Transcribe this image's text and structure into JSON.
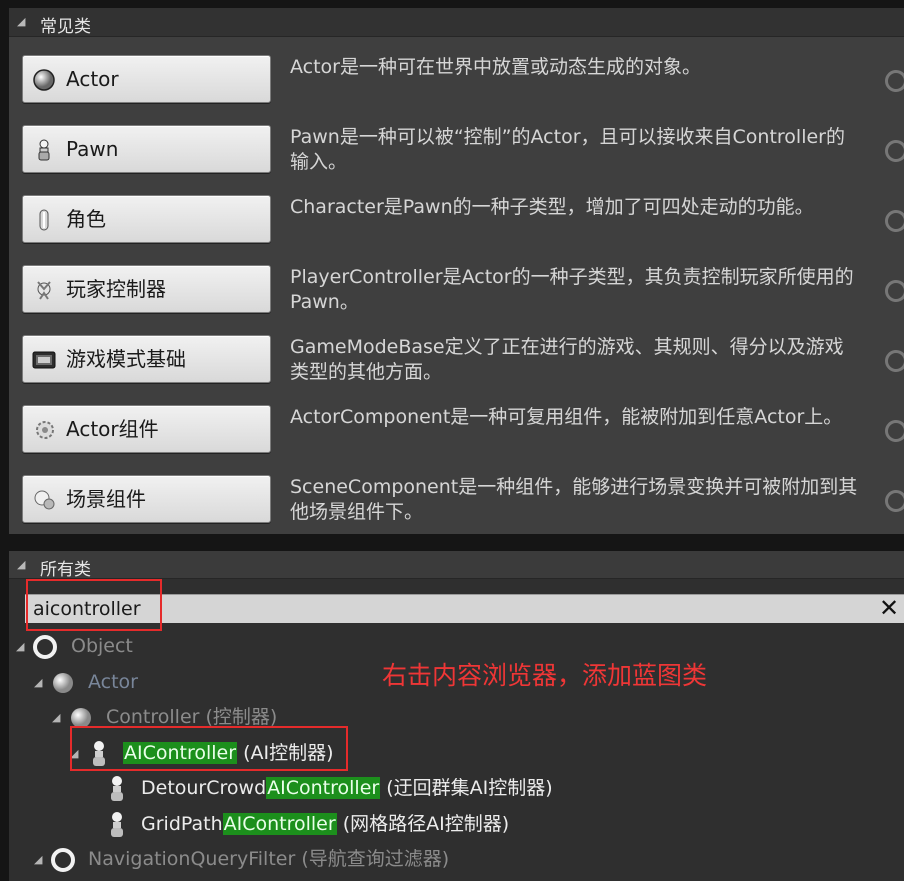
{
  "common": {
    "title": "常见类",
    "items": [
      {
        "label": "Actor",
        "icon": "actor-sphere-icon",
        "desc": "Actor是一种可在世界中放置或动态生成的对象。"
      },
      {
        "label": "Pawn",
        "icon": "pawn-icon",
        "desc": "Pawn是一种可以被“控制”的Actor，且可以接收来自Controller的输入。"
      },
      {
        "label": "角色",
        "icon": "character-icon",
        "desc": "Character是Pawn的一种子类型，增加了可四处走动的功能。"
      },
      {
        "label": "玩家控制器",
        "icon": "player-controller-icon",
        "desc": "PlayerController是Actor的一种子类型，其负责控制玩家所使用的Pawn。"
      },
      {
        "label": "游戏模式基础",
        "icon": "game-mode-icon",
        "desc": "GameModeBase定义了正在进行的游戏、其规则、得分以及游戏类型的其他方面。"
      },
      {
        "label": "Actor组件",
        "icon": "actor-component-icon",
        "desc": "ActorComponent是一种可复用组件，能被附加到任意Actor上。"
      },
      {
        "label": "场景组件",
        "icon": "scene-component-icon",
        "desc": "SceneComponent是一种组件，能够进行场景变换并可被附加到其他场景组件下。"
      }
    ]
  },
  "all_classes": {
    "title": "所有类",
    "search_value": "aicontroller",
    "tree": [
      {
        "text": "Object",
        "suffix": ""
      },
      {
        "text": "Actor",
        "suffix": ""
      },
      {
        "text": "Controller",
        "suffix": " (控制器)"
      },
      {
        "prefix": "",
        "match": "AIController",
        "suffix": " (AI控制器)"
      },
      {
        "prefix": "DetourCrowd",
        "match": "AIController",
        "suffix": " (迂回群集AI控制器)"
      },
      {
        "prefix": "GridPath",
        "match": "AIController",
        "suffix": " (网格路径AI控制器)"
      },
      {
        "text": "NavigationQueryFilter",
        "suffix": " (导航查询过滤器)"
      }
    ]
  },
  "annotation": "右击内容浏览器，添加蓝图类"
}
